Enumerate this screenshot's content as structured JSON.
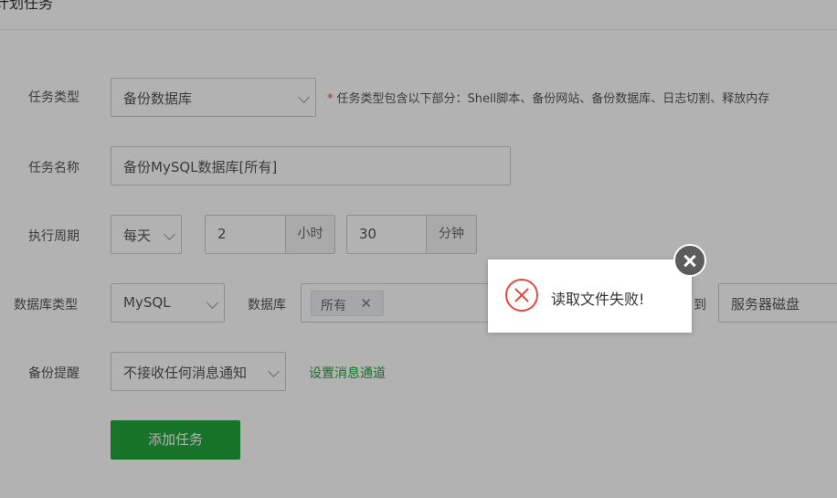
{
  "page": {
    "title": "计划任务"
  },
  "form": {
    "task_type": {
      "label": "任务类型",
      "value": "备份数据库",
      "hint": "任务类型包含以下部分：Shell脚本、备份网站、备份数据库、日志切割、释放内存"
    },
    "task_name": {
      "label": "任务名称",
      "value": "备份MySQL数据库[所有]"
    },
    "cycle": {
      "label": "执行周期",
      "period": "每天",
      "hours": "2",
      "hours_unit": "小时",
      "minutes": "30",
      "minutes_unit": "分钟"
    },
    "db_type": {
      "label": "数据库类型",
      "value": "MySQL"
    },
    "database": {
      "label": "数据库",
      "tag": "所有",
      "tag_remove": "✕"
    },
    "backup_to": {
      "label_partial": "到",
      "value": "服务器磁盘"
    },
    "notify": {
      "label": "备份提醒",
      "value": "不接收任何消息通知",
      "link": "设置消息通道"
    },
    "submit": {
      "label": "添加任务"
    }
  },
  "toast": {
    "message": "读取文件失败!",
    "icon": "error-circle-icon",
    "close_icon": "close-icon"
  },
  "colors": {
    "accent": "#20a53a",
    "error": "#e0493d",
    "overlay": "rgba(0,0,0,0.30)"
  }
}
